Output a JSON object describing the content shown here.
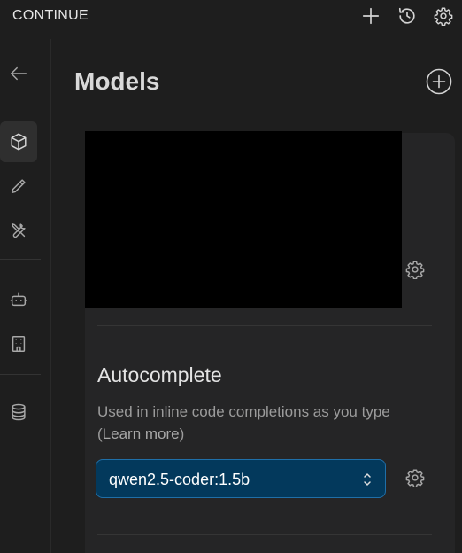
{
  "header": {
    "title": "CONTINUE"
  },
  "main": {
    "title": "Models",
    "autocomplete": {
      "title": "Autocomplete",
      "description_prefix": "Used in inline code completions as you type (",
      "learn_more": "Learn more",
      "description_suffix": ")",
      "selected_model": "qwen2.5-coder:1.5b"
    }
  },
  "icons": {
    "header": [
      "plus-icon",
      "history-icon",
      "gear-icon"
    ],
    "rail": [
      "back-arrow-icon",
      "cube-icon",
      "pencil-icon",
      "tools-icon",
      "robot-icon",
      "building-icon",
      "database-icon"
    ]
  },
  "colors": {
    "background": "#1e1e1e",
    "card": "#252526",
    "select_bg": "#03395c",
    "select_border": "#1f6fa8"
  }
}
